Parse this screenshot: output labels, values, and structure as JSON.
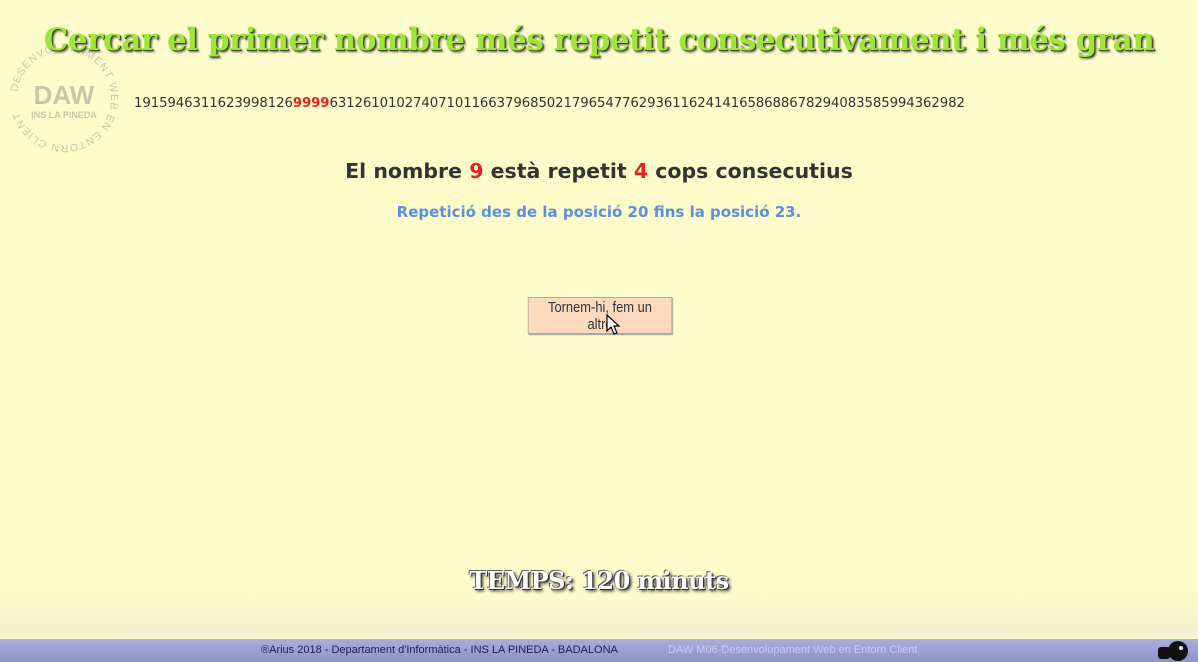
{
  "logo": {
    "abbr": "DAW",
    "school": "INS LA PINEDA",
    "ring_text": "DESENVOLUPAMENT WEB EN ENTORN CLIENT"
  },
  "header": {
    "title": "Cercar el primer nombre més repetit consecutivament i més gran"
  },
  "sequence": {
    "before": "1915946311623998126",
    "highlight": "9999",
    "after": "6312610102740710116637968502179654776293611624141658688678294083585994362982"
  },
  "result": {
    "prefix": "El nombre ",
    "number": "9",
    "middle": " està repetit ",
    "count": "4",
    "suffix": " cops consecutius"
  },
  "range": {
    "text": "Repetició des de la posició 20 fins la posició 23."
  },
  "actions": {
    "again_label": "Tornem-hi, fem un altre"
  },
  "timer": {
    "text": "TEMPS: 120 minuts"
  },
  "footer": {
    "left_text": "®Arius 2018 - Departament d'Informàtica - INS LA PINEDA - BADALONA",
    "right_text": "DAW M06-Desenvolupament Web en Entorn Client"
  },
  "colors": {
    "background": "#fffccb",
    "title": "#a0e63a",
    "highlight": "#e5241f",
    "range_text": "#5b8fe0",
    "button": "#fbdac0",
    "footer": "#9ea3d4"
  }
}
